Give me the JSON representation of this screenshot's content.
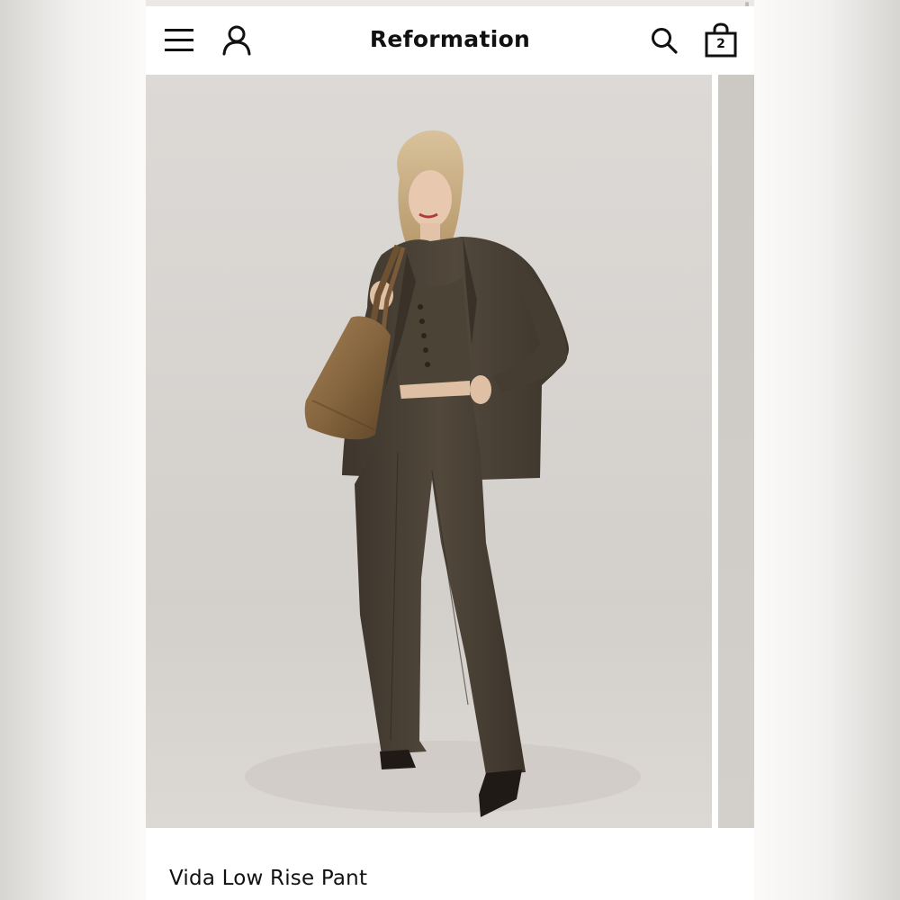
{
  "header": {
    "brand": "Reformation",
    "menu_icon": "hamburger-menu-icon",
    "account_icon": "account-user-icon",
    "search_icon": "search-icon",
    "bag_icon": "shopping-bag-icon",
    "bag_count": "2"
  },
  "product": {
    "title": "Vida Low Rise Pant"
  },
  "colors": {
    "text": "#111111",
    "background": "#ffffff",
    "garment": "#4a4136",
    "bag": "#8b6a45"
  }
}
